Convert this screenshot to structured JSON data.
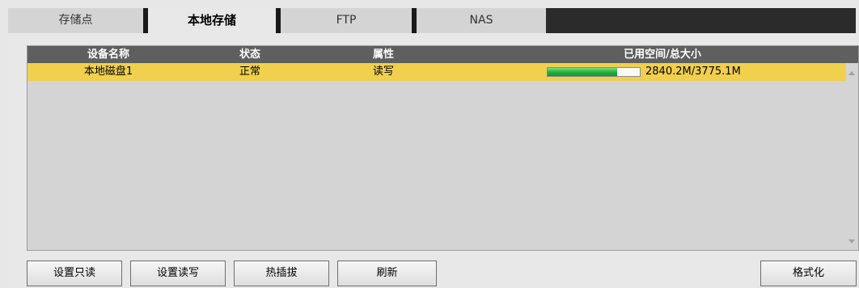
{
  "tabs": [
    {
      "label": "存储点",
      "active": false
    },
    {
      "label": "本地存储",
      "active": true
    },
    {
      "label": "FTP",
      "active": false
    },
    {
      "label": "NAS",
      "active": false
    }
  ],
  "table": {
    "columns": [
      "设备名称",
      "状态",
      "属性",
      "已用空间/总大小"
    ],
    "rows": [
      {
        "name": "本地磁盘1",
        "status": "正常",
        "attribute": "读写",
        "usage": "2840.2M/3775.1M",
        "used_fraction": 0.752
      }
    ]
  },
  "buttons": {
    "read_only": "设置只读",
    "read_write": "设置读写",
    "hot_swap": "热插拔",
    "refresh": "刷新",
    "format": "格式化"
  },
  "colors": {
    "selected_row": "#f0d04c",
    "header_bg": "#5f5f5f",
    "tabbar_bg": "#2b2b2b",
    "progress_fill": "#1fae3c"
  },
  "icons": {
    "scroll_up": "chevron-up-icon",
    "scroll_down": "chevron-down-icon"
  }
}
